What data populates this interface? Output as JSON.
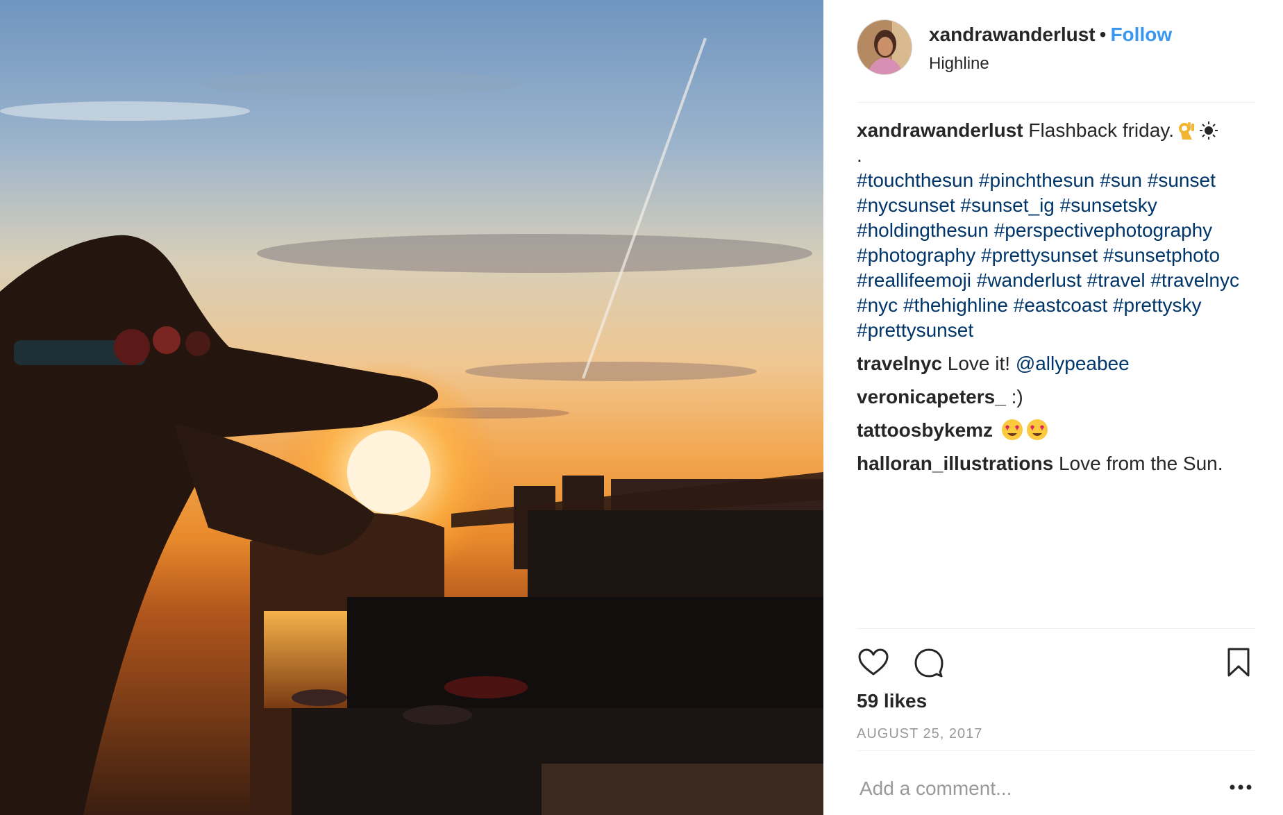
{
  "post": {
    "username": "xandrawanderlust",
    "separator": "•",
    "follow_label": "Follow",
    "location": "Highline"
  },
  "caption": {
    "username": "xandrawanderlust",
    "text": "Flashback friday.",
    "emoji_1": "ok-hand-emoji",
    "emoji_2": "sun-emoji",
    "dot_line": ".",
    "hashtags": [
      "#touchthesun",
      "#pinchthesun",
      "#sun",
      "#sunset",
      "#nycsunset",
      "#sunset_ig",
      "#sunsetsky",
      "#holdingthesun",
      "#perspectivephotography",
      "#photography",
      "#prettysunset",
      "#sunsetphoto",
      "#reallifeemoji",
      "#wanderlust",
      "#travel",
      "#travelnyc",
      "#nyc",
      "#thehighline",
      "#eastcoast",
      "#prettysky",
      "#prettysunset"
    ]
  },
  "comments": [
    {
      "username": "travelnyc",
      "text": "Love it!",
      "mention": "@allypeabee"
    },
    {
      "username": "veronicapeters_",
      "text": ":)"
    },
    {
      "username": "tattoosbykemz",
      "emoji": "heart-eyes-emoji"
    },
    {
      "username": "halloran_illustrations",
      "text": "Love from the Sun."
    }
  ],
  "actions": {
    "like_icon": "heart-icon",
    "comment_icon": "comment-bubble-icon",
    "save_icon": "bookmark-icon"
  },
  "likes": "59 likes",
  "date": "AUGUST 25, 2017",
  "add_comment": {
    "placeholder": "Add a comment..."
  },
  "more_icon": "more-options-icon",
  "colors": {
    "follow": "#3897f0",
    "hashtag": "#003569",
    "text": "#262626",
    "muted": "#999999",
    "divider": "#efefef"
  }
}
